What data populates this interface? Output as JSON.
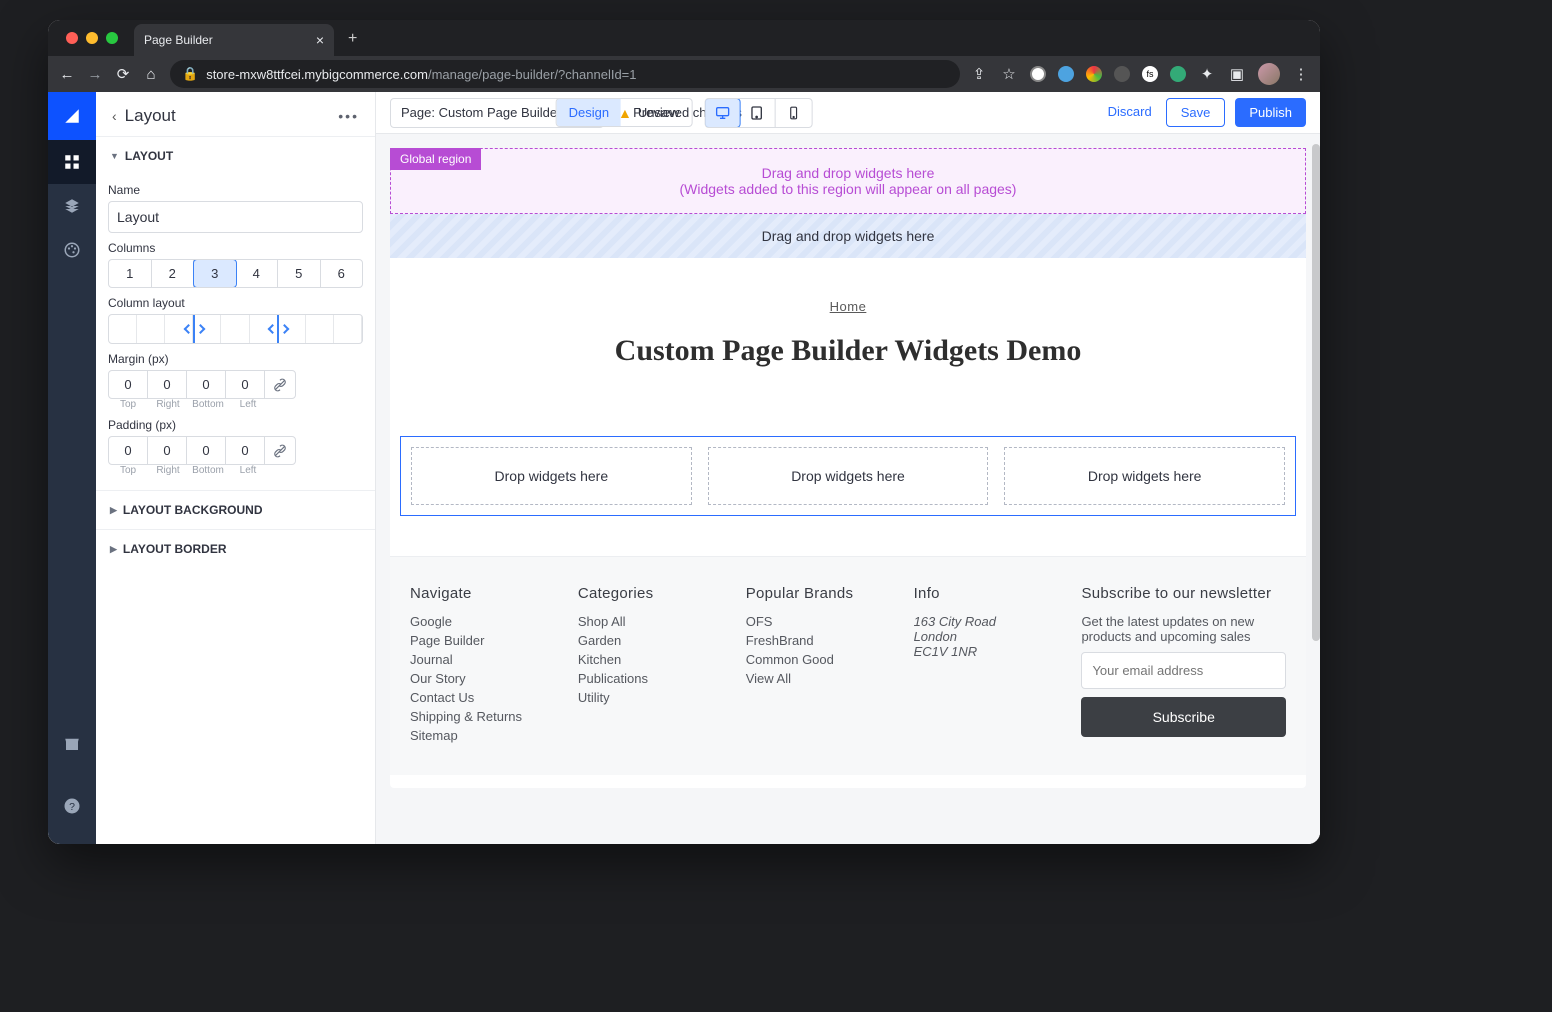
{
  "browser": {
    "tab_title": "Page Builder",
    "url_host": "store-mxw8ttfcei.mybigcommerce.com",
    "url_path": "/manage/page-builder/?channelId=1"
  },
  "topbar": {
    "page_dropdown": "Page: Custom Page Builder Widge...",
    "unsaved_label": "Unsaved changes",
    "mode_design": "Design",
    "mode_preview": "Preview",
    "discard": "Discard",
    "save": "Save",
    "publish": "Publish"
  },
  "panel": {
    "title": "Layout",
    "section_layout": "LAYOUT",
    "name_label": "Name",
    "name_value": "Layout",
    "columns_label": "Columns",
    "column_options": [
      "1",
      "2",
      "3",
      "4",
      "5",
      "6"
    ],
    "columns_selected": "3",
    "column_layout_label": "Column layout",
    "margin_label": "Margin (px)",
    "padding_label": "Padding (px)",
    "spacing_values": {
      "top": "0",
      "right": "0",
      "bottom": "0",
      "left": "0"
    },
    "spacing_labels": [
      "Top",
      "Right",
      "Bottom",
      "Left"
    ],
    "section_background": "LAYOUT BACKGROUND",
    "section_border": "LAYOUT BORDER"
  },
  "canvas": {
    "global_tag": "Global region",
    "global_line1": "Drag and drop widgets here",
    "global_line2": "(Widgets added to this region will appear on all pages)",
    "blue_region": "Drag and drop widgets here",
    "breadcrumb": "Home",
    "page_title": "Custom Page Builder Widgets Demo",
    "dropzone": "Drop widgets here"
  },
  "footer": {
    "navigate": {
      "title": "Navigate",
      "items": [
        "Google",
        "Page Builder",
        "Journal",
        "Our Story",
        "Contact Us",
        "Shipping & Returns",
        "Sitemap"
      ]
    },
    "categories": {
      "title": "Categories",
      "items": [
        "Shop All",
        "Garden",
        "Kitchen",
        "Publications",
        "Utility"
      ]
    },
    "brands": {
      "title": "Popular Brands",
      "items": [
        "OFS",
        "FreshBrand",
        "Common Good",
        "View All"
      ]
    },
    "info": {
      "title": "Info",
      "lines": [
        "163 City Road",
        "London",
        "EC1V 1NR"
      ]
    },
    "subscribe": {
      "title": "Subscribe to our newsletter",
      "blurb": "Get the latest updates on new products and upcoming sales",
      "placeholder": "Your email address",
      "button": "Subscribe"
    }
  }
}
